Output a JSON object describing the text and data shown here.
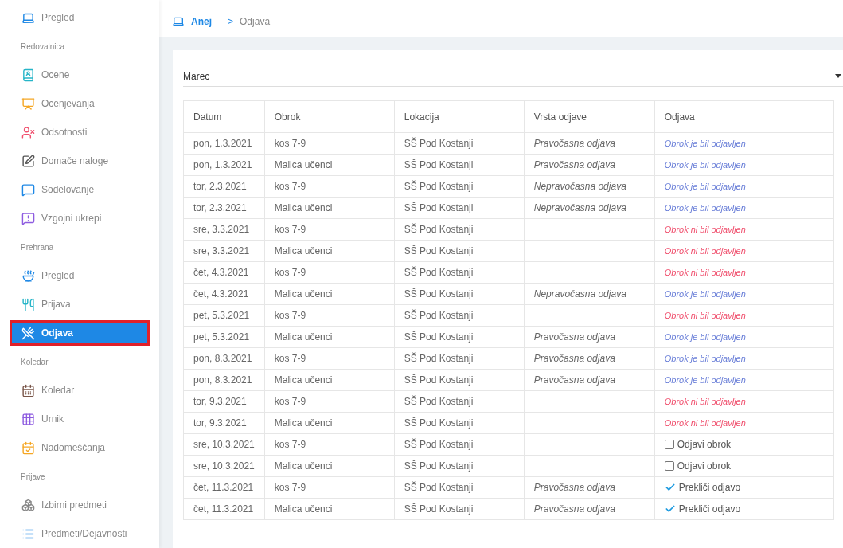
{
  "sidebar": {
    "items": [
      {
        "kind": "item",
        "label": "Pregled",
        "selected": false
      },
      {
        "kind": "section",
        "label": "Redovalnica"
      },
      {
        "kind": "item",
        "label": "Ocene",
        "selected": false
      },
      {
        "kind": "item",
        "label": "Ocenjevanja",
        "selected": false
      },
      {
        "kind": "item",
        "label": "Odsotnosti",
        "selected": false
      },
      {
        "kind": "item",
        "label": "Domače naloge",
        "selected": false
      },
      {
        "kind": "item",
        "label": "Sodelovanje",
        "selected": false
      },
      {
        "kind": "item",
        "label": "Vzgojni ukrepi",
        "selected": false
      },
      {
        "kind": "section",
        "label": "Prehrana"
      },
      {
        "kind": "item",
        "label": "Pregled",
        "selected": false
      },
      {
        "kind": "item",
        "label": "Prijava",
        "selected": false
      },
      {
        "kind": "item",
        "label": "Odjava",
        "selected": true
      },
      {
        "kind": "section",
        "label": "Koledar"
      },
      {
        "kind": "item",
        "label": "Koledar",
        "selected": false
      },
      {
        "kind": "item",
        "label": "Urnik",
        "selected": false
      },
      {
        "kind": "item",
        "label": "Nadomeščanja",
        "selected": false
      },
      {
        "kind": "section",
        "label": "Prijave"
      },
      {
        "kind": "item",
        "label": "Izbirni predmeti",
        "selected": false
      },
      {
        "kind": "item",
        "label": "Predmeti/Dejavnosti",
        "selected": false
      }
    ]
  },
  "breadcrumb": {
    "home": "Anej",
    "separator": ">",
    "current": "Odjava"
  },
  "month_select": {
    "value": "Marec"
  },
  "table": {
    "columns": [
      "Datum",
      "Obrok",
      "Lokacija",
      "Vrsta odjave",
      "Odjava"
    ],
    "rows": [
      {
        "date": "pon, 1.3.2021",
        "meal": "kos 7-9",
        "location": "SŠ Pod Kostanji",
        "type": "Pravočasna odjava",
        "odjava": {
          "kind": "status",
          "text": "Obrok je bil odjavljen",
          "logged_out": true
        }
      },
      {
        "date": "pon, 1.3.2021",
        "meal": "Malica učenci",
        "location": "SŠ Pod Kostanji",
        "type": "Pravočasna odjava",
        "odjava": {
          "kind": "status",
          "text": "Obrok je bil odjavljen",
          "logged_out": true
        }
      },
      {
        "date": "tor, 2.3.2021",
        "meal": "kos 7-9",
        "location": "SŠ Pod Kostanji",
        "type": "Nepravočasna odjava",
        "odjava": {
          "kind": "status",
          "text": "Obrok je bil odjavljen",
          "logged_out": true
        }
      },
      {
        "date": "tor, 2.3.2021",
        "meal": "Malica učenci",
        "location": "SŠ Pod Kostanji",
        "type": "Nepravočasna odjava",
        "odjava": {
          "kind": "status",
          "text": "Obrok je bil odjavljen",
          "logged_out": true
        }
      },
      {
        "date": "sre, 3.3.2021",
        "meal": "kos 7-9",
        "location": "SŠ Pod Kostanji",
        "odjava": {
          "kind": "status",
          "text": "Obrok ni bil odjavljen",
          "logged_out": false
        }
      },
      {
        "date": "sre, 3.3.2021",
        "meal": "Malica učenci",
        "location": "SŠ Pod Kostanji",
        "odjava": {
          "kind": "status",
          "text": "Obrok ni bil odjavljen",
          "logged_out": false
        }
      },
      {
        "date": "čet, 4.3.2021",
        "meal": "kos 7-9",
        "location": "SŠ Pod Kostanji",
        "odjava": {
          "kind": "status",
          "text": "Obrok ni bil odjavljen",
          "logged_out": false
        }
      },
      {
        "date": "čet, 4.3.2021",
        "meal": "Malica učenci",
        "location": "SŠ Pod Kostanji",
        "type": "Nepravočasna odjava",
        "odjava": {
          "kind": "status",
          "text": "Obrok je bil odjavljen",
          "logged_out": true
        }
      },
      {
        "date": "pet, 5.3.2021",
        "meal": "kos 7-9",
        "location": "SŠ Pod Kostanji",
        "odjava": {
          "kind": "status",
          "text": "Obrok ni bil odjavljen",
          "logged_out": false
        }
      },
      {
        "date": "pet, 5.3.2021",
        "meal": "Malica učenci",
        "location": "SŠ Pod Kostanji",
        "type": "Pravočasna odjava",
        "odjava": {
          "kind": "status",
          "text": "Obrok je bil odjavljen",
          "logged_out": true
        }
      },
      {
        "date": "pon, 8.3.2021",
        "meal": "kos 7-9",
        "location": "SŠ Pod Kostanji",
        "type": "Pravočasna odjava",
        "odjava": {
          "kind": "status",
          "text": "Obrok je bil odjavljen",
          "logged_out": true
        }
      },
      {
        "date": "pon, 8.3.2021",
        "meal": "Malica učenci",
        "location": "SŠ Pod Kostanji",
        "type": "Pravočasna odjava",
        "odjava": {
          "kind": "status",
          "text": "Obrok je bil odjavljen",
          "logged_out": true
        }
      },
      {
        "date": "tor, 9.3.2021",
        "meal": "kos 7-9",
        "location": "SŠ Pod Kostanji",
        "odjava": {
          "kind": "status",
          "text": "Obrok ni bil odjavljen",
          "logged_out": false
        }
      },
      {
        "date": "tor, 9.3.2021",
        "meal": "Malica učenci",
        "location": "SŠ Pod Kostanji",
        "odjava": {
          "kind": "status",
          "text": "Obrok ni bil odjavljen",
          "logged_out": false
        }
      },
      {
        "date": "sre, 10.3.2021",
        "meal": "kos 7-9",
        "location": "SŠ Pod Kostanji",
        "odjava": {
          "kind": "action",
          "text": "Odjavi obrok",
          "checked": false
        }
      },
      {
        "date": "sre, 10.3.2021",
        "meal": "Malica učenci",
        "location": "SŠ Pod Kostanji",
        "odjava": {
          "kind": "action",
          "text": "Odjavi obrok",
          "checked": false
        }
      },
      {
        "date": "čet, 11.3.2021",
        "meal": "kos 7-9",
        "location": "SŠ Pod Kostanji",
        "type": "Pravočasna odjava",
        "odjava": {
          "kind": "action",
          "text": "Prekliči odjavo",
          "checked": true
        }
      },
      {
        "date": "čet, 11.3.2021",
        "meal": "Malica učenci",
        "location": "SŠ Pod Kostanji",
        "type": "Pravočasna odjava",
        "odjava": {
          "kind": "action",
          "text": "Prekliči odjavo",
          "checked": true
        }
      }
    ]
  }
}
